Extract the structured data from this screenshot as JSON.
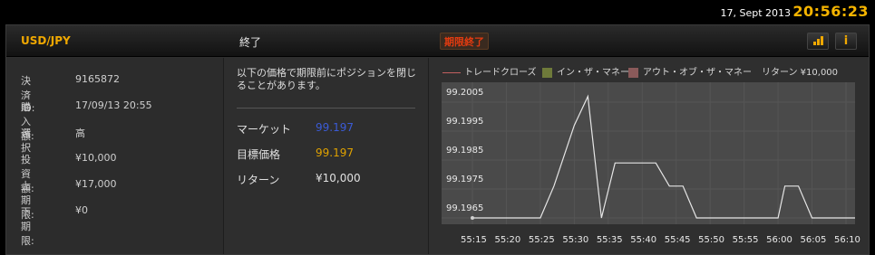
{
  "topbar": {
    "date": "17, Sept 2013",
    "time": "20:56:23"
  },
  "header": {
    "pair": "USD/JPY",
    "status": "終了",
    "badge": "期限終了"
  },
  "details": [
    {
      "key": "決済ID:",
      "value": "9165872"
    },
    {
      "key": "購入額:",
      "value": "17/09/13 20:55"
    },
    {
      "key": "選択",
      "value": "高"
    },
    {
      "key": "投資額:",
      "value": "¥10,000"
    },
    {
      "key": "上期限:",
      "value": "¥17,000"
    },
    {
      "key": "下期限:",
      "value": "¥0"
    }
  ],
  "middle": {
    "note": "以下の価格で期限前にポジションを閉じることがあります。",
    "rows": [
      {
        "key": "マーケット",
        "value": "99.197",
        "color": "#3b5bd6"
      },
      {
        "key": "目標価格",
        "value": "99.197",
        "color": "#e0a200"
      },
      {
        "key": "リターン",
        "value": "¥10,000",
        "color": "#e0e0e0"
      }
    ]
  },
  "legend": {
    "line": "トレードクローズ",
    "in_money": "イン・ザ・マネー",
    "out_money": "アウト・オブ・ザ・マネー",
    "return": "リターン ¥10,000",
    "colors": {
      "line": "#c26060",
      "in_money": "#6e7a3a",
      "out_money": "#8a5a5a"
    }
  },
  "chart_data": {
    "type": "line",
    "y_ticks": [
      "99.2005",
      "99.1995",
      "99.1985",
      "99.1975",
      "99.1965"
    ],
    "x_ticks": [
      "55:15",
      "55:20",
      "55:25",
      "55:30",
      "55:35",
      "55:40",
      "55:45",
      "55:50",
      "55:55",
      "56:00",
      "56:05",
      "56:10"
    ],
    "ylim": [
      99.1965,
      99.201
    ],
    "series": [
      {
        "values": [
          [
            "55:15",
            99.1965
          ],
          [
            "55:20",
            99.1965
          ],
          [
            "55:25",
            99.1965
          ],
          [
            "55:27",
            99.1976
          ],
          [
            "55:30",
            99.1997
          ],
          [
            "55:32",
            99.2007
          ],
          [
            "55:34",
            99.1965
          ],
          [
            "55:36",
            99.1984
          ],
          [
            "55:42",
            99.1984
          ],
          [
            "55:44",
            99.1976
          ],
          [
            "55:46",
            99.1976
          ],
          [
            "55:48",
            99.1965
          ],
          [
            "55:55",
            99.1965
          ],
          [
            "56:00",
            99.1965
          ],
          [
            "56:01",
            99.1976
          ],
          [
            "56:03",
            99.1976
          ],
          [
            "56:05",
            99.1965
          ],
          [
            "56:10",
            99.1965
          ],
          [
            "56:14",
            99.1965
          ]
        ]
      }
    ]
  }
}
